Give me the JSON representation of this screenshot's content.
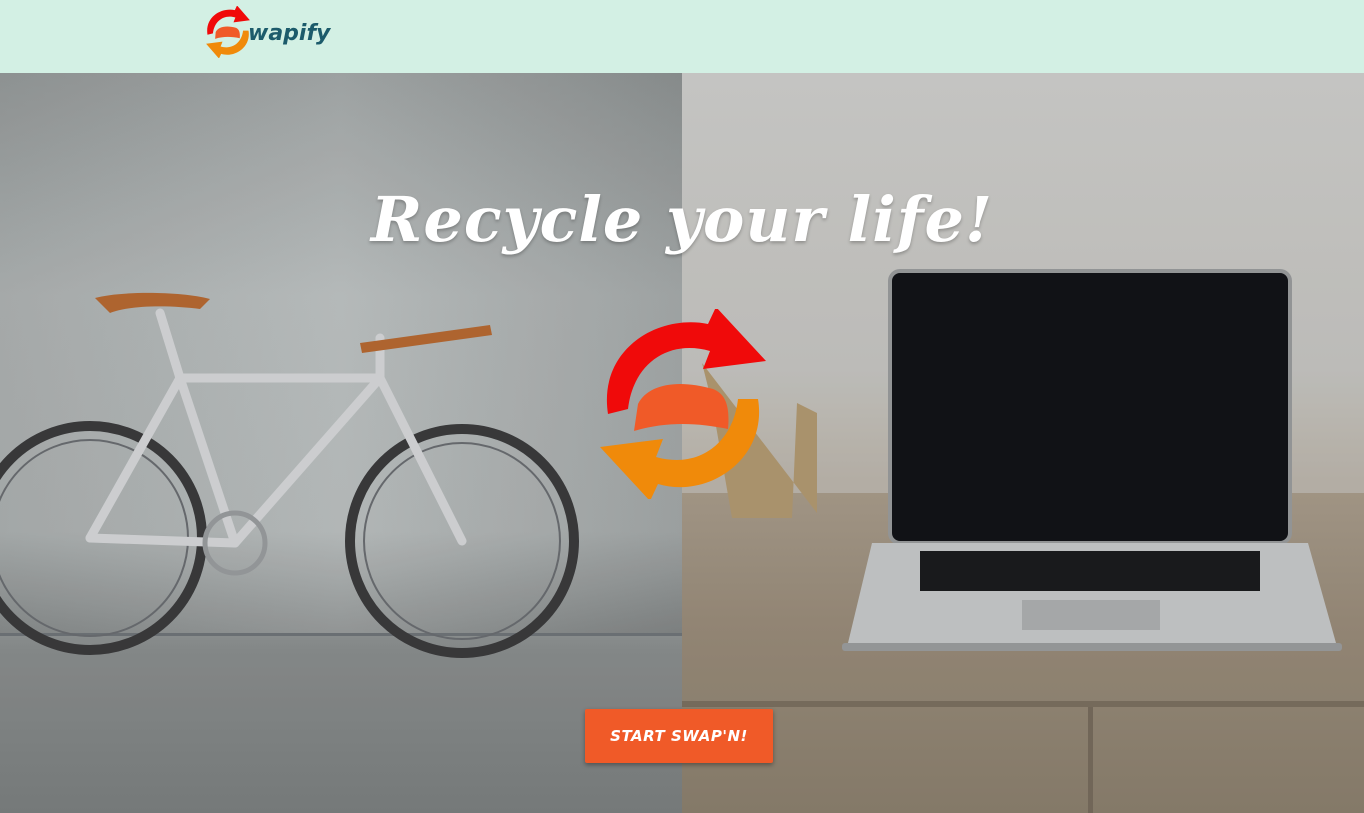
{
  "navbar": {
    "brand_text": "wapify",
    "logo_icon": "swap-arrows-icon",
    "background": "#d3f0e4",
    "brand_color": "#1c5b6b"
  },
  "hero": {
    "title": "Recycle your life!",
    "logo_icon": "swap-arrows-icon",
    "cta_label": "START SWAP'N!",
    "cta_color": "#f05a28"
  },
  "colors": {
    "arrow_red": "#f00a0a",
    "arrow_orange": "#f08a0a",
    "s_band": "#f05a28"
  }
}
